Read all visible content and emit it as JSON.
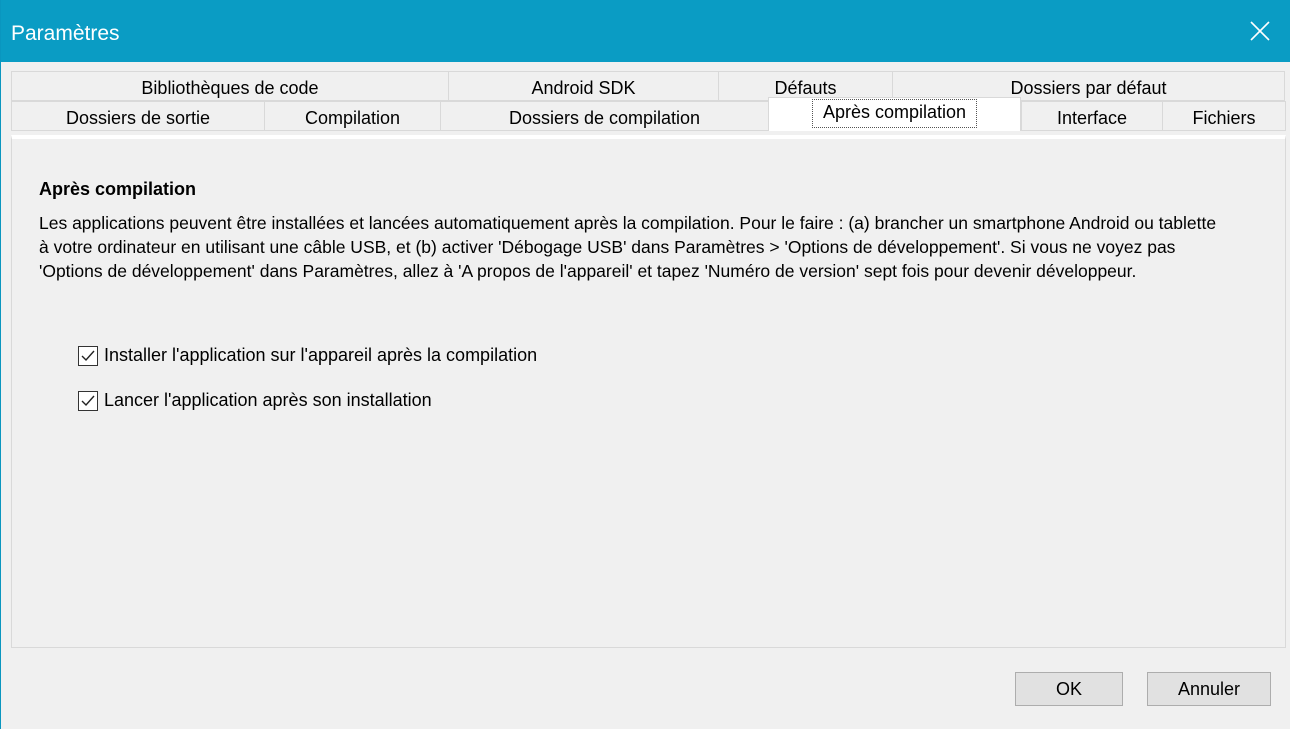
{
  "window": {
    "title": "Paramètres",
    "accent_color": "#0a9cc4"
  },
  "tabs": {
    "row1": [
      {
        "label": "Bibliothèques de code"
      },
      {
        "label": "Android SDK"
      },
      {
        "label": "Défauts"
      },
      {
        "label": "Dossiers par défaut"
      }
    ],
    "row2": [
      {
        "label": "Dossiers de sortie"
      },
      {
        "label": "Compilation"
      },
      {
        "label": "Dossiers de compilation"
      },
      {
        "label": "Après compilation",
        "active": true
      },
      {
        "label": "Interface"
      },
      {
        "label": "Fichiers"
      }
    ]
  },
  "panel": {
    "section_title": "Après compilation",
    "description": "Les applications peuvent être installées et lancées automatiquement après la compilation. Pour le faire : (a) brancher un smartphone Android ou tablette à votre ordinateur en utilisant une câble USB, et (b) activer 'Débogage USB' dans Paramètres > 'Options de développement'. Si vous ne voyez pas 'Options de développement' dans Paramètres, allez à 'A propos de l'appareil' et tapez 'Numéro de version' sept fois pour devenir développeur.",
    "checkboxes": [
      {
        "label": "Installer l'application sur l'appareil après la compilation",
        "checked": true
      },
      {
        "label": "Lancer l'application après son installation",
        "checked": true
      }
    ]
  },
  "buttons": {
    "ok": "OK",
    "cancel": "Annuler"
  },
  "icons": {
    "close": "close-icon",
    "check": "check-icon"
  }
}
